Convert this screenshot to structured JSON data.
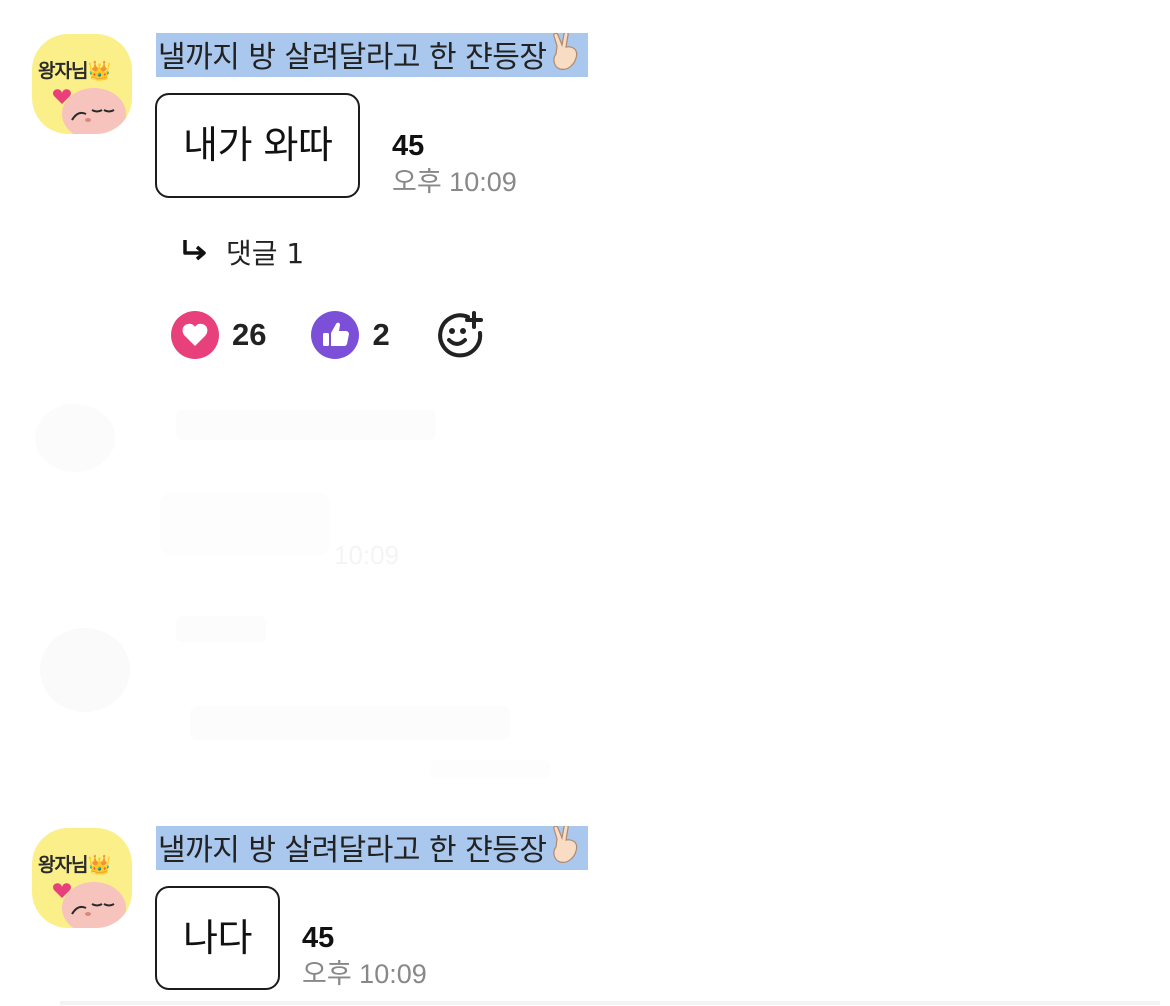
{
  "messages": [
    {
      "avatar_label": "왕자님👑",
      "sender_name": "낼까지 방 살려달라고 한 쟌등장",
      "text": "내가 와따",
      "unread_count": "45",
      "time": "오후 10:09",
      "reply_label": "댓글 1",
      "reactions": [
        {
          "icon": "heart-icon",
          "count": "26",
          "color": "#e8407a"
        },
        {
          "icon": "thumbs-up-icon",
          "count": "2",
          "color": "#7b4fd8"
        }
      ]
    },
    {
      "avatar_label": "왕자님👑",
      "sender_name": "낼까지 방 살려달라고 한 쟌등장",
      "text": "나다",
      "unread_count": "45",
      "time": "오후 10:09"
    }
  ],
  "ghost": {
    "time": "10:09"
  },
  "colors": {
    "name_highlight": "#aac7ee",
    "avatar_bg": "#fbef8a",
    "heart": "#e8407a",
    "thumb": "#7b4fd8"
  }
}
